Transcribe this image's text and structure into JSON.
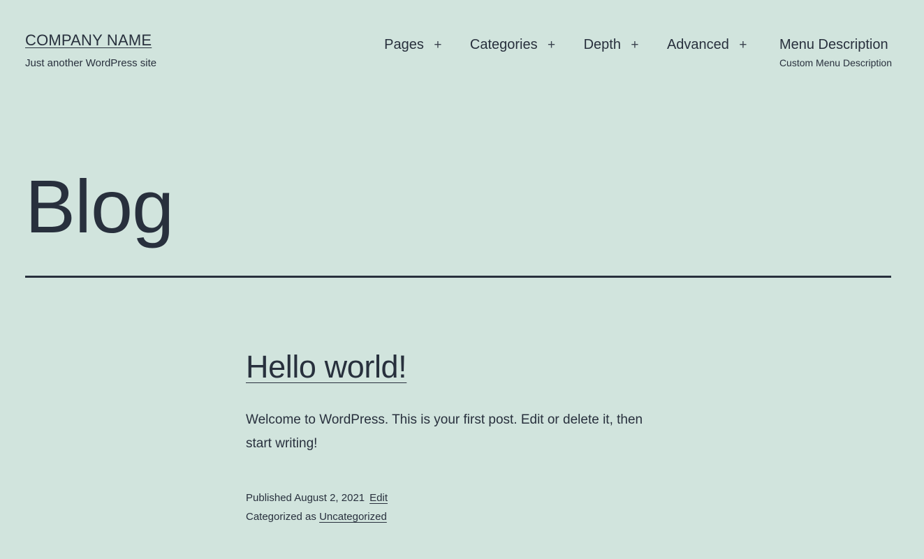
{
  "site": {
    "background_color": "#d1e4dd",
    "text_color": "#28303d",
    "title": "COMPANY NAME",
    "tagline": "Just another WordPress site"
  },
  "nav": {
    "items": [
      {
        "label": "Pages",
        "has_submenu_toggle": true,
        "toggle_icon": "plus-icon",
        "description": ""
      },
      {
        "label": "Categories",
        "has_submenu_toggle": true,
        "toggle_icon": "plus-icon",
        "description": ""
      },
      {
        "label": "Depth",
        "has_submenu_toggle": true,
        "toggle_icon": "plus-icon",
        "description": ""
      },
      {
        "label": "Advanced",
        "has_submenu_toggle": true,
        "toggle_icon": "plus-icon",
        "description": ""
      },
      {
        "label": "Menu Description",
        "has_submenu_toggle": false,
        "toggle_icon": "",
        "description": "Custom Menu Description"
      }
    ],
    "toggle_glyph": "+"
  },
  "archive": {
    "title": "Blog"
  },
  "posts": [
    {
      "title": "Hello world!",
      "excerpt": "Welcome to WordPress. This is your first post. Edit or delete it, then start writing!",
      "published_label": "Published August 2, 2021",
      "edit_label": "Edit",
      "category_prefix": "Categorized as",
      "category_label": "Uncategorized"
    }
  ]
}
